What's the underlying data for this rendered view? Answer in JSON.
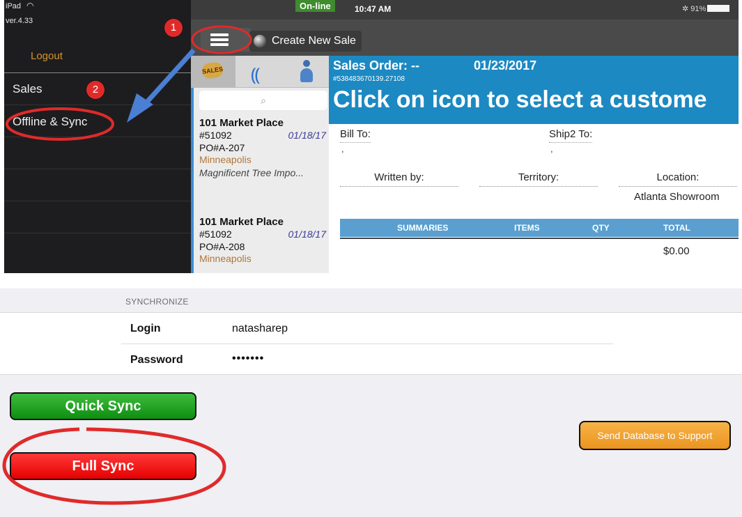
{
  "drawer": {
    "device": "iPad",
    "version": "ver.4.33",
    "logout": "Logout",
    "items": [
      {
        "label": "Sales"
      },
      {
        "label": "Offline & Sync"
      }
    ]
  },
  "annotations": {
    "step1": "1",
    "step2": "2"
  },
  "status_bar": {
    "online": "On-line",
    "time": "10:47 AM",
    "battery": "91%"
  },
  "toolbar": {
    "create_new_sale": "Create New Sale"
  },
  "tabs": {
    "sales_tag": "SALES"
  },
  "orders": [
    {
      "customer": "101 Market Place",
      "number": "#51092",
      "date": "01/18/17",
      "po": "PO#A-207",
      "city": "Minneapolis",
      "company": "Magnificent Tree Impo..."
    },
    {
      "customer": "101 Market Place",
      "number": "#51092",
      "date": "01/18/17",
      "po": "PO#A-208",
      "city": "Minneapolis"
    }
  ],
  "sales_order": {
    "title": "Sales Order: --",
    "date": "01/23/2017",
    "id": "#538483670139.27108",
    "call_to_action": "Click on icon to select a custome",
    "bill_to": "Bill To:",
    "ship_to": "Ship2 To:",
    "bill_to_value": ",",
    "ship_to_value": ",",
    "written_by": "Written by:",
    "territory": "Territory:",
    "location": "Location:",
    "location_value": "Atlanta Showroom",
    "columns": [
      "SUMMARIES",
      "ITEMS",
      "QTY",
      "TOTAL"
    ],
    "total": "$0.00"
  },
  "sync": {
    "section": "SYNCHRONIZE",
    "login_label": "Login",
    "login_value": "natasharep",
    "password_label": "Password",
    "password_value": "•••••••",
    "quick_sync": "Quick Sync",
    "full_sync": "Full Sync",
    "send_db": "Send Database to Support"
  },
  "colors": {
    "header_blue": "#1c89c2",
    "online_green": "#3e8c2e",
    "quick_sync_green": "#0e8f10",
    "full_sync_red": "#e60000",
    "send_db_orange": "#ea9420",
    "annotation_red": "#e02a2a",
    "annotation_arrow_blue": "#4a7fd4"
  }
}
